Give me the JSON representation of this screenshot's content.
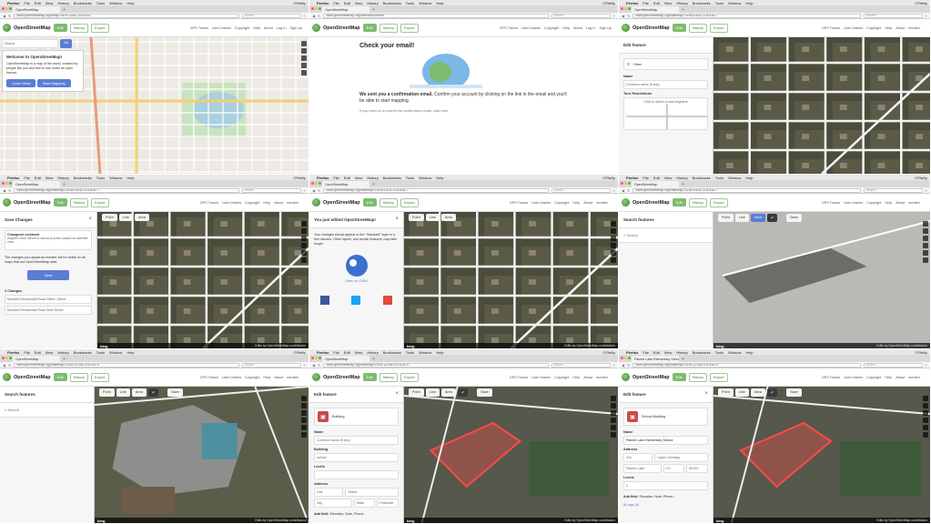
{
  "colors": {
    "osm_green": "#7ebc6f",
    "iD_blue": "#5b7dd6",
    "selection_red": "#ff4a4a"
  },
  "mac": {
    "app": "Firefox",
    "menu": [
      "File",
      "Edit",
      "View",
      "History",
      "Bookmarks",
      "Tools",
      "Window",
      "Help"
    ],
    "right": "O'Reilly"
  },
  "tabs": {
    "p1": "OpenStreetMap",
    "p2": "OpenStreetMap",
    "p3": "OpenStreetMap",
    "p4": "OpenStreetMap",
    "p5": "OpenStreetMap",
    "p6": "OpenStreetMap",
    "p7": "OpenStreetMap",
    "p8": "OpenStreetMap",
    "p9": "Palmer Lake Elementary School"
  },
  "urls": {
    "p1": "www.openstreetmap.org/#map=16/39.1184/-104.8748",
    "p2": "www.openstreetmap.org/user/new/confirm",
    "p3": "www.openstreetmap.org/edit#map=19/38.91631/-104.81677",
    "p4": "www.openstreetmap.org/edit#map=19/38.91631/-104.81677",
    "p5": "www.openstreetmap.org/edit#map=19/38.91631/-104.81677",
    "p6": "www.openstreetmap.org/edit#map=20/38.91631/-104.81677",
    "p7": "www.openstreetmap.org/edit#map=19/39.12196/-104.91679",
    "p8": "www.openstreetmap.org/edit#map=19/39.12196/-104.91679",
    "p9": "www.openstreetmap.org/edit#map=19/39.12196/-104.91679"
  },
  "browser": {
    "search_placeholder": "Search"
  },
  "osm": {
    "brand": "OpenStreetMap",
    "edit": "Edit",
    "history": "History",
    "export": "Export",
    "nav": [
      "GPS Traces",
      "User Diaries",
      "Copyright",
      "Help",
      "About"
    ],
    "login": "Log In",
    "signup": "Sign Up",
    "user": "mmater"
  },
  "p1": {
    "search_placeholder": "Search",
    "go": "Go",
    "welcome_title": "Welcome to OpenStreetMap!",
    "welcome_text": "OpenStreetMap is a map of the world, created by people like you and free to use under an open license.",
    "learn_more": "Learn More",
    "start_mapping": "Start Mapping"
  },
  "p2": {
    "heading": "Check your email!",
    "sent_strong": "We sent you a confirmation email.",
    "sent_rest": "Confirm your account by clicking on the link in the email and you'll be able to start mapping.",
    "resend": "If you need us to resend the confirmation email, click here."
  },
  "p3": {
    "sidebar_title": "Edit feature",
    "preset": "Other",
    "name_label": "Name",
    "name_placeholder": "Common name (if any)",
    "turn_label": "Turn Restrictions",
    "turn_hint": "Click to select a road segment"
  },
  "editor": {
    "point": "Point",
    "line": "Line",
    "area": "Area",
    "save": "Save",
    "bing": "bing",
    "footer": "Edits by OpenStreetMap contributors"
  },
  "p4": {
    "title": "Save Changes",
    "comment_label": "Changeset comment",
    "comment_value": "Aligned Dixie Street to actual position based on satellite view.",
    "note": "The changes you upload as mmater will be visible on all maps that use OpenStreetMap data.",
    "save": "Save",
    "changes_title": "2 Changes",
    "changes": [
      "Modified Residential Road Gilfern Street",
      "Modified Residential Road Dixie Street"
    ]
  },
  "p5": {
    "title": "You just edited OpenStreetMap!",
    "text": "Your changes should appear in the \"Standard\" layer in a few minutes. Other layers, and certain features, may take longer.",
    "view": "View on OSM"
  },
  "p6": {
    "title": "Search features",
    "search_placeholder": "Search"
  },
  "p7": {
    "title": "Search features",
    "search_placeholder": "Search"
  },
  "p8": {
    "title": "Edit feature",
    "preset": "Building",
    "name_label": "Name",
    "name_placeholder": "Common name (if any)",
    "building_label": "Building",
    "building_value": "school",
    "levels_label": "Levels",
    "address_label": "Address",
    "unit": "Unit",
    "street": "Street",
    "city": "City",
    "state": "State",
    "postcode": "Postcode",
    "add_field": "Add field:",
    "add_field_options": "Elevation, Note, Phone..."
  },
  "p9": {
    "title": "Edit feature",
    "preset": "School Building",
    "name_label": "Name",
    "name_value": "Palmer Lake Elementary School",
    "address_label": "Address",
    "housenumber": "115",
    "street": "Upper Glenway",
    "city": "Palmer Lake",
    "state": "CO",
    "postcode": "80133",
    "levels_label": "Levels",
    "levels_value": "2",
    "add_field": "Add field:",
    "add_field_options": "Elevation, Note, Phone...",
    "all_tags": "All tags (6)"
  }
}
